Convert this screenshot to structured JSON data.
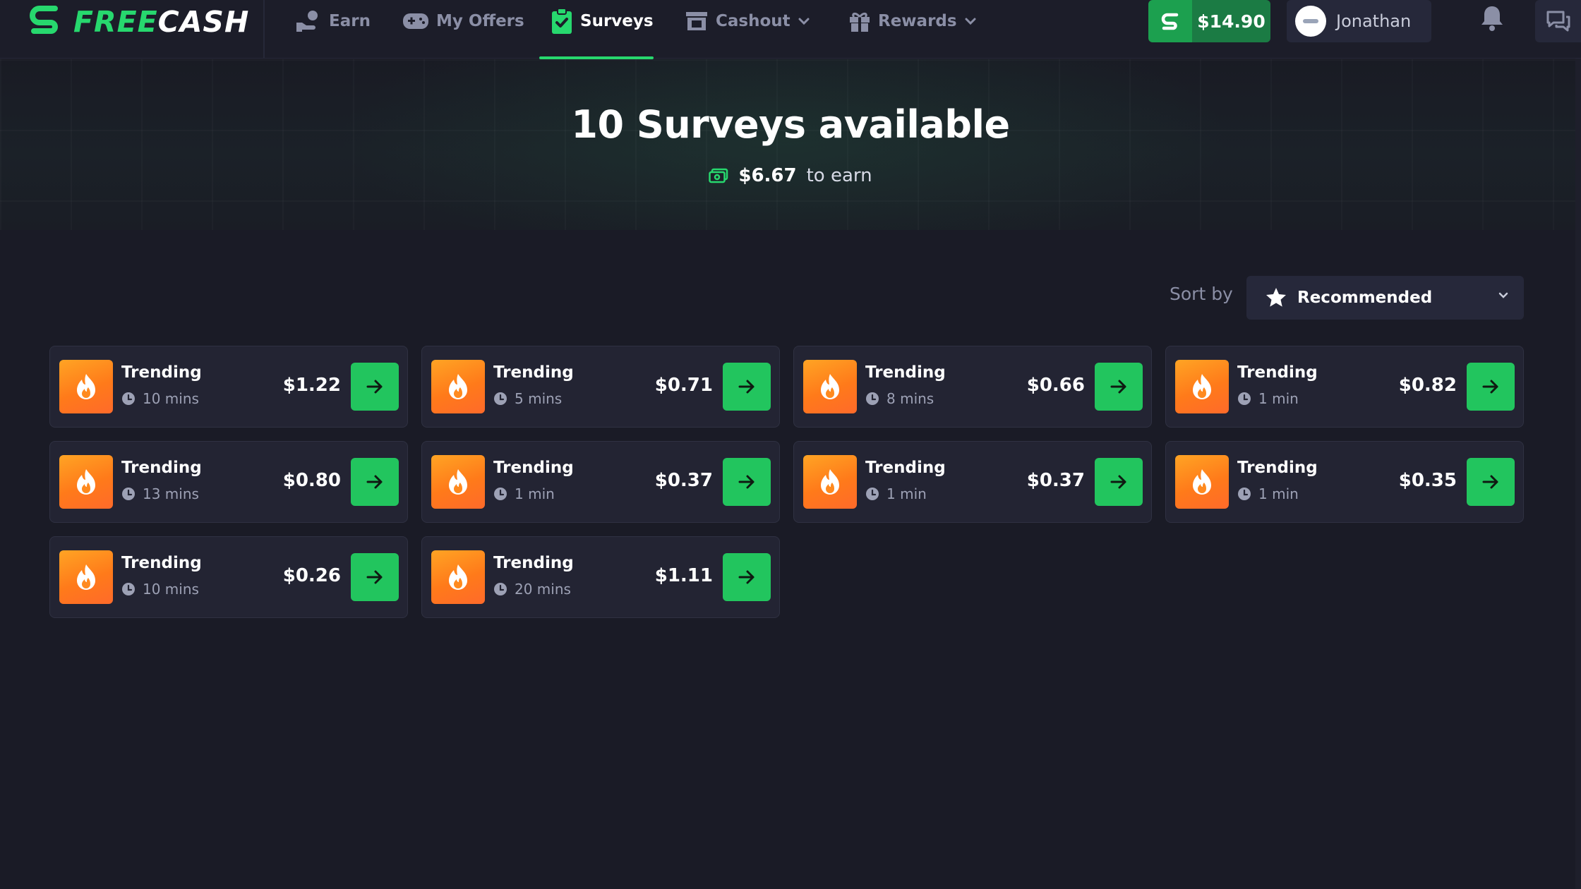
{
  "brand": {
    "part1": "FREE",
    "part2": "CASH"
  },
  "nav": {
    "earn": "Earn",
    "my_offers": "My Offers",
    "surveys": "Surveys",
    "cashout": "Cashout",
    "rewards": "Rewards"
  },
  "header": {
    "balance": "$14.90",
    "user_name": "Jonathan"
  },
  "hero": {
    "title": "10 Surveys available",
    "amount": "$6.67",
    "suffix": "to earn"
  },
  "sort": {
    "label": "Sort by",
    "selected": "Recommended"
  },
  "colors": {
    "accent": "#22c55e",
    "brand_green": "#27d86e",
    "badge_orange": "#ff8a1f",
    "background": "#1a1b26",
    "card": "#232433"
  },
  "icons": [
    "earn-icon",
    "offers-icon",
    "surveys-icon",
    "cashout-icon",
    "rewards-icon",
    "chevron-down-icon",
    "coin-icon",
    "bell-icon",
    "chat-icon",
    "money-icon",
    "star-icon",
    "flame-icon",
    "clock-icon",
    "arrow-right-icon"
  ],
  "surveys": [
    {
      "label": "Trending",
      "duration": "10 mins",
      "price": "$1.22"
    },
    {
      "label": "Trending",
      "duration": "5 mins",
      "price": "$0.71"
    },
    {
      "label": "Trending",
      "duration": "8 mins",
      "price": "$0.66"
    },
    {
      "label": "Trending",
      "duration": "1 min",
      "price": "$0.82"
    },
    {
      "label": "Trending",
      "duration": "13 mins",
      "price": "$0.80"
    },
    {
      "label": "Trending",
      "duration": "1 min",
      "price": "$0.37"
    },
    {
      "label": "Trending",
      "duration": "1 min",
      "price": "$0.37"
    },
    {
      "label": "Trending",
      "duration": "1 min",
      "price": "$0.35"
    },
    {
      "label": "Trending",
      "duration": "10 mins",
      "price": "$0.26"
    },
    {
      "label": "Trending",
      "duration": "20 mins",
      "price": "$1.11"
    }
  ]
}
